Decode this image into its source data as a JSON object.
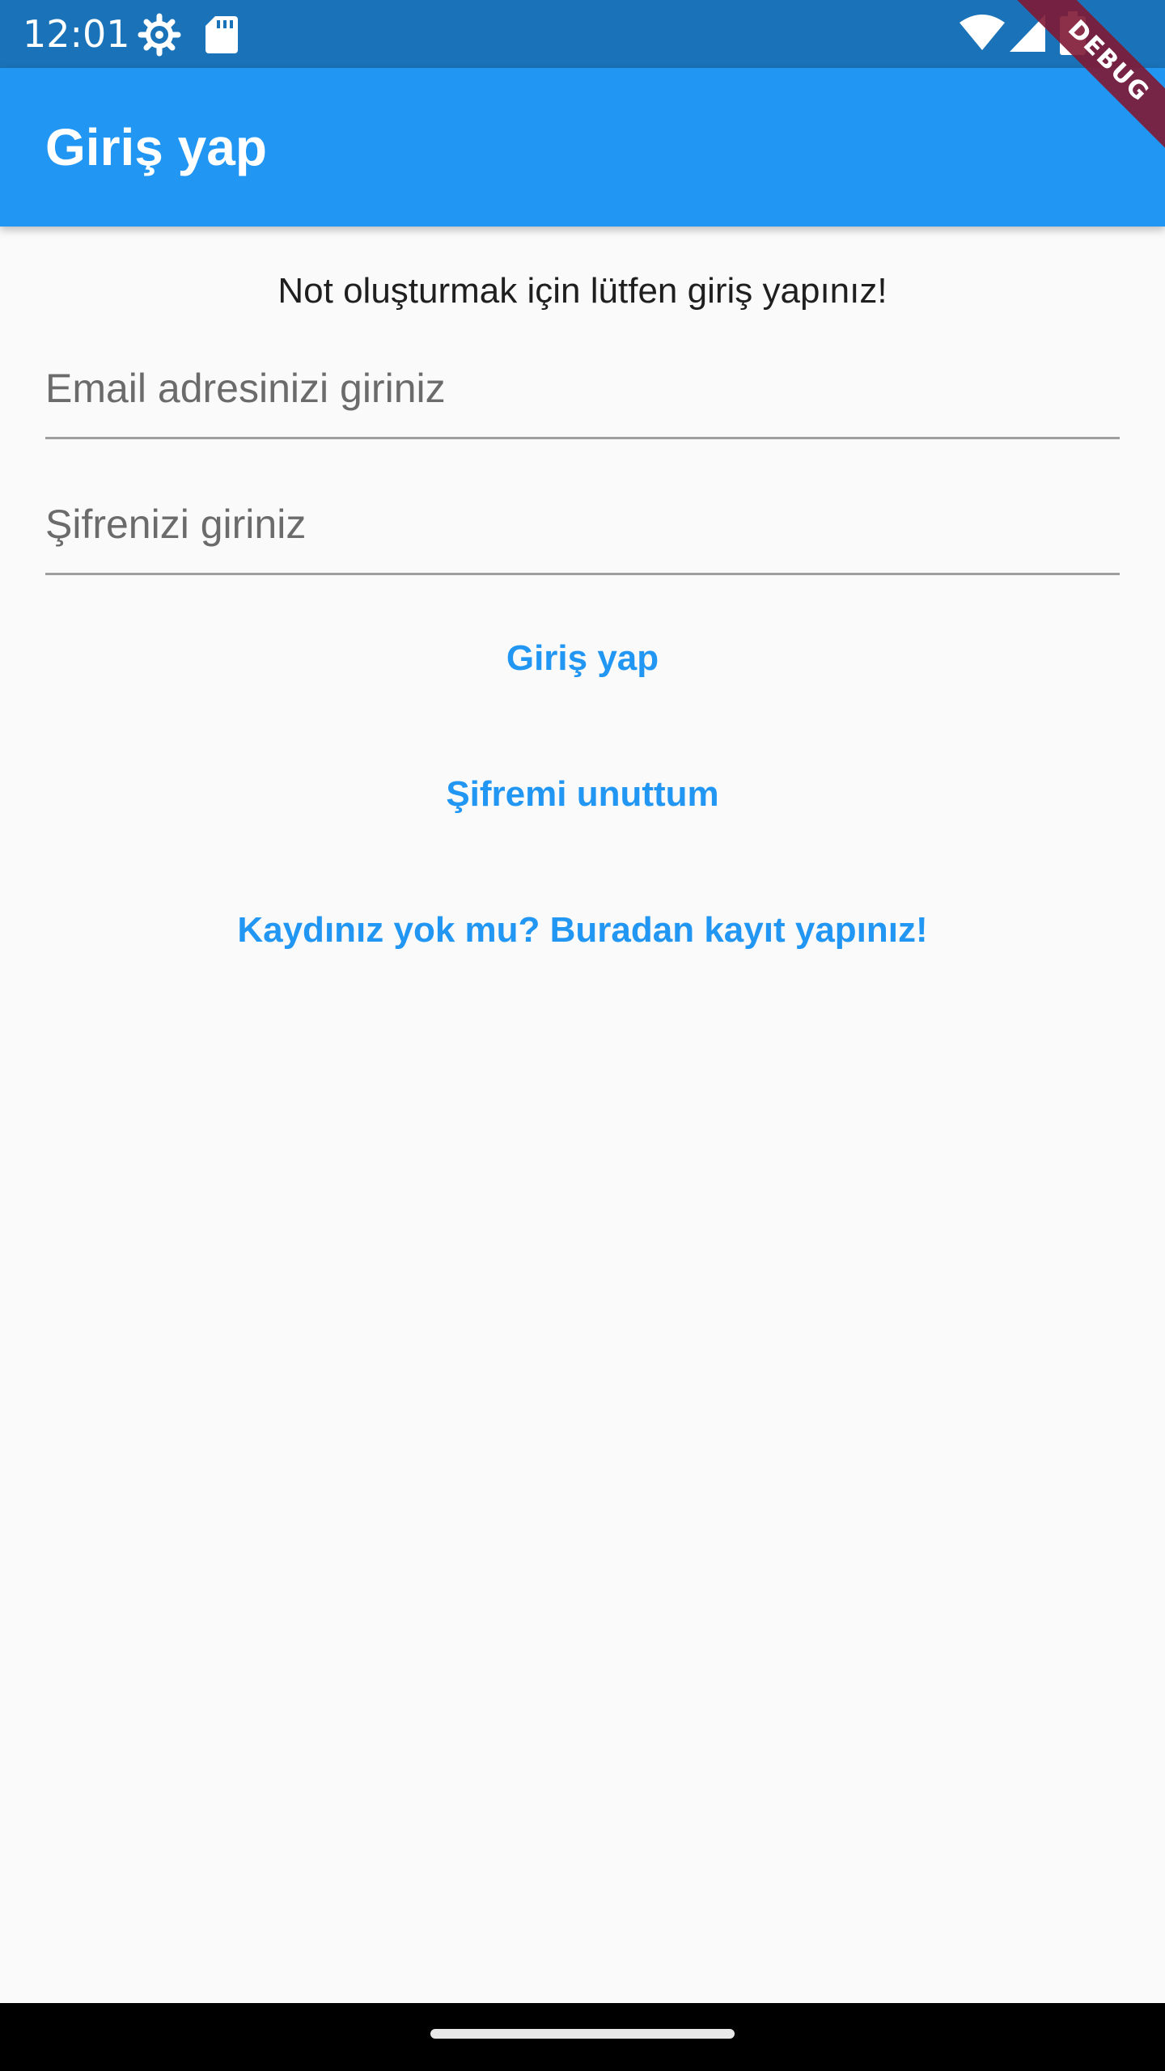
{
  "status_bar": {
    "time": "12:01",
    "icons_left": [
      "settings-gear-icon",
      "sd-card-icon"
    ],
    "icons_right": [
      "wifi-icon",
      "cell-signal-icon",
      "battery-icon"
    ]
  },
  "app_bar": {
    "title": "Giriş yap",
    "debug_banner": "DEBUG"
  },
  "main": {
    "info_text": "Not oluşturmak için lütfen giriş yapınız!",
    "email_field": {
      "placeholder": "Email adresinizi giriniz",
      "value": ""
    },
    "password_field": {
      "placeholder": "Şifrenizi giriniz",
      "value": ""
    },
    "login_button": "Giriş yap",
    "forgot_password_button": "Şifremi unuttum",
    "register_button": "Kaydınız yok mu? Buradan kayıt yapınız!"
  },
  "colors": {
    "status_bar": "#1a73b8",
    "app_bar": "#2196f3",
    "accent": "#2196f3",
    "background": "#fafafa",
    "debug_ribbon": "#801834"
  }
}
